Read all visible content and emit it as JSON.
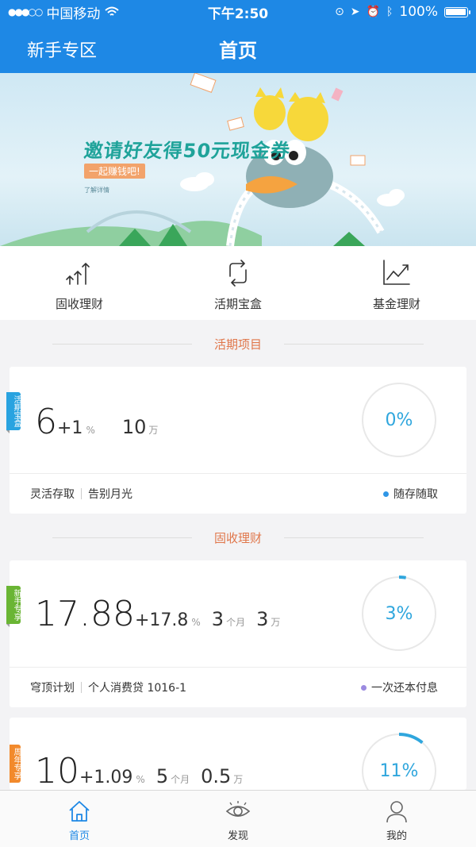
{
  "status_bar": {
    "carrier": "中国移动",
    "time": "下午2:50",
    "battery": "100%"
  },
  "nav": {
    "left_label": "新手专区",
    "title": "首页"
  },
  "banner": {
    "headline": "邀请好友得50元现金券",
    "subline": "一起赚钱吧!",
    "link": "了解详情"
  },
  "quick_menu": [
    {
      "label": "固收理财",
      "icon": "rising-bars-icon"
    },
    {
      "label": "活期宝盒",
      "icon": "cycle-arrows-icon"
    },
    {
      "label": "基金理财",
      "icon": "trend-chart-icon"
    }
  ],
  "sections": {
    "current": "活期项目",
    "fixed": "固收理财"
  },
  "cards": [
    {
      "ribbon": "活期宝盒",
      "ribbon_color": "#29a3e0",
      "rate": "6",
      "bonus": "+1",
      "rate_unit": "%",
      "term_value": "",
      "term_unit": "",
      "amount_value": "10",
      "amount_unit": "万",
      "progress_label": "0%",
      "progress": 0,
      "tag1": "灵活存取",
      "tag2": "告别月光",
      "right_tag": "随存随取",
      "right_dot_color": "#2f96e6"
    },
    {
      "ribbon": "新手专享",
      "ribbon_color": "#6ab534",
      "rate": "17.88",
      "bonus": "+17.8",
      "rate_unit": "%",
      "term_value": "3",
      "term_unit": "个月",
      "amount_value": "3",
      "amount_unit": "万",
      "progress_label": "3%",
      "progress": 0.03,
      "tag1": "穹顶计划",
      "tag2": "个人消费贷 1016-1",
      "right_tag": "一次还本付息",
      "right_dot_color": "#9b8ae0"
    },
    {
      "ribbon": "周年专享",
      "ribbon_color": "#f28a2c",
      "rate": "10",
      "bonus": "+1.09",
      "rate_unit": "%",
      "term_value": "5",
      "term_unit": "个月",
      "amount_value": "0.5",
      "amount_unit": "万",
      "progress_label": "11%",
      "progress": 0.11
    }
  ],
  "tabs": [
    {
      "label": "首页",
      "icon": "home-icon",
      "active": true
    },
    {
      "label": "发现",
      "icon": "eye-icon",
      "active": false
    },
    {
      "label": "我的",
      "icon": "user-icon",
      "active": false
    }
  ],
  "colors": {
    "primary": "#1e88e5",
    "accent": "#e0764a",
    "ring": "#2fa6dd"
  }
}
